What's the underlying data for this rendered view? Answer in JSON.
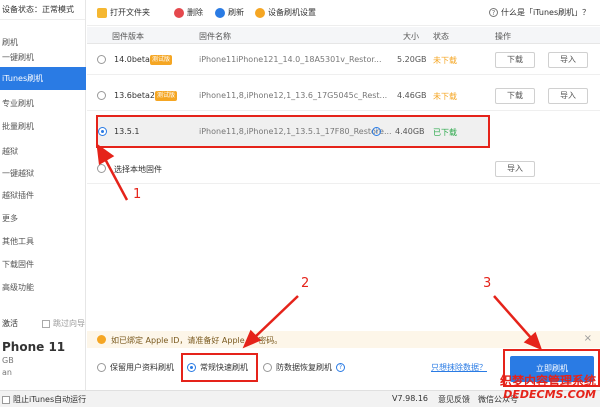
{
  "sidebar": {
    "status": "设备状态：正常模式",
    "items": [
      "刷机",
      "一键刷机",
      "iTunes刷机",
      "专业刷机",
      "批量刷机",
      "越狱",
      "一键越狱",
      "越狱插件",
      "更多",
      "其他工具",
      "下载固件",
      "高级功能"
    ],
    "activate_label": "激活",
    "skip_guide": "跳过向导",
    "device_name": "Phone 11",
    "device_storage": "GB",
    "device_extra": "an"
  },
  "toolbar": {
    "open_folder": "打开文件夹",
    "delete": "删除",
    "refresh": "刷新",
    "device_settings": "设备刷机设置",
    "help": "什么是「iTunes刷机」？"
  },
  "table": {
    "headers": {
      "version": "固件版本",
      "name": "固件名称",
      "size": "大小",
      "status": "状态",
      "action": "操作"
    },
    "rows": [
      {
        "version": "14.0beta",
        "badge": "测试版",
        "name": "iPhone11iPhone121_14.0_18A5301v_Restor...",
        "size": "5.20GB",
        "status": "未下载",
        "download": "下载",
        "import": "导入"
      },
      {
        "version": "13.6beta2",
        "badge": "测试版",
        "name": "iPhone11,8,iPhone12,1_13.6_17G5045c_Rest...",
        "size": "4.46GB",
        "status": "未下载",
        "download": "下载",
        "import": "导入"
      },
      {
        "version": "13.5.1",
        "name": "iPhone11,8,iPhone12,1_13.5.1_17F80_Restore...",
        "size": "4.40GB",
        "status": "已下载"
      }
    ],
    "local_label": "选择本地固件",
    "local_import": "导入"
  },
  "notice": "如已绑定 Apple ID，请准备好 Apple ID 密码。",
  "options": {
    "keep": "保留用户资料刷机",
    "normal": "常规快速刷机",
    "anti": "防数据恢复刷机",
    "erase_link": "只想抹除数据？",
    "flash_button": "立即刷机"
  },
  "statusbar": {
    "auto_itunes": "阻止iTunes自动运行",
    "version": "V7.98.16",
    "feedback": "意见反馈",
    "wechat": "微信公众号"
  },
  "annotations": [
    "1",
    "2",
    "3"
  ],
  "watermark": {
    "line1": "织梦内容管理系统",
    "line2": "DEDECMS.COM"
  },
  "colors": {
    "accent": "#2a7be4",
    "annotation": "#e5231a",
    "orange": "#f5a623",
    "green": "#2aa84a"
  }
}
